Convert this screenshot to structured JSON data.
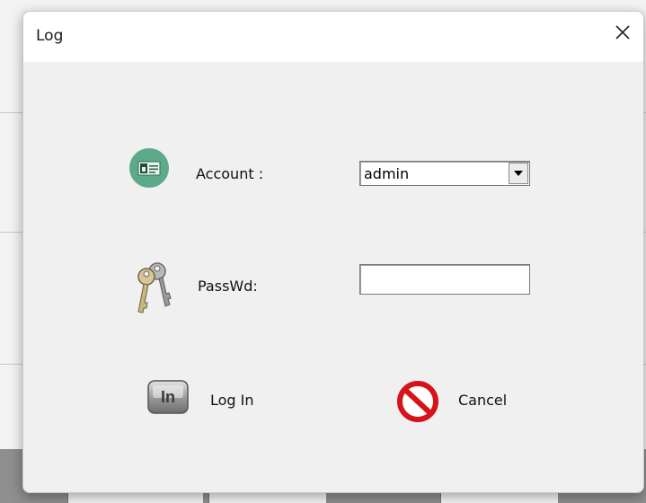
{
  "dialog": {
    "title": "Log",
    "close_icon": "close-icon"
  },
  "form": {
    "account_label": "Account :",
    "account_value": "admin",
    "account_icon": "account-card-icon",
    "password_label": "PassWd:",
    "password_value": "",
    "password_icon": "keys-icon"
  },
  "buttons": {
    "login_label": "Log In",
    "login_icon": "login-icon",
    "cancel_label": "Cancel",
    "cancel_icon": "prohibited-icon"
  },
  "colors": {
    "account_icon": "#5daa8a",
    "cancel_icon": "#d4141a",
    "dialog_bg": "#f0f0f0",
    "titlebar_bg": "#ffffff"
  }
}
